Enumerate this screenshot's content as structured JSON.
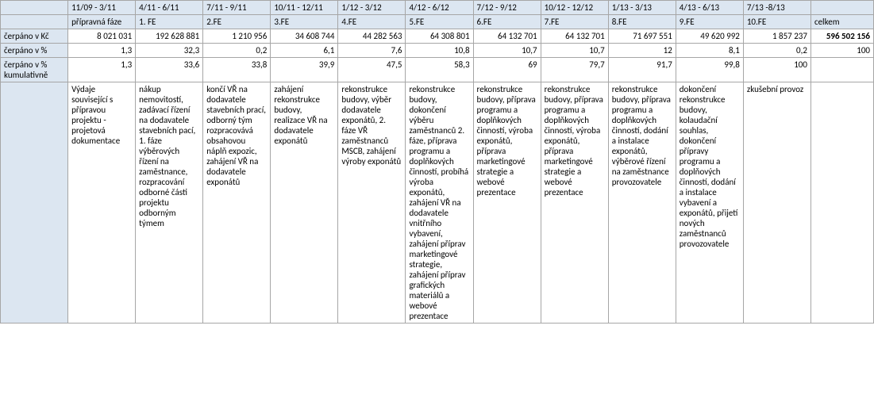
{
  "row_labels": [
    "",
    "",
    "čerpáno v Kč",
    "čerpáno v %",
    "čerpáno v % kumulativně",
    ""
  ],
  "periods": [
    "11/09 - 3/11",
    "4/11 - 6/11",
    "7/11 - 9/11",
    "10/11 - 12/11",
    "1/12 - 3/12",
    "4/12 - 6/12",
    "7/12 - 9/12",
    "10/12 - 12/12",
    "1/13 - 3/13",
    "4/13 - 6/13",
    "7/13 -8/13"
  ],
  "phases": [
    "přípravná fáze",
    "1. FE",
    "2.FE",
    "3.FE",
    "4.FE",
    "5.FE",
    "6.FE",
    "7.FE",
    "8.FE",
    "9.FE",
    "10.FE"
  ],
  "kc": [
    "8 021 031",
    "192 628 881",
    "1 210 956",
    "34 608 744",
    "44 282 563",
    "64 308 801",
    "64 132 701",
    "64 132 701",
    "71 697 551",
    "49 620 992",
    "1 857 237"
  ],
  "pct": [
    "1,3",
    "32,3",
    "0,2",
    "6,1",
    "7,6",
    "10,8",
    "10,7",
    "10,7",
    "12",
    "8,1",
    "0,2"
  ],
  "cum": [
    "1,3",
    "33,6",
    "33,8",
    "39,9",
    "47,5",
    "58,3",
    "69",
    "79,7",
    "91,7",
    "99,8",
    "100"
  ],
  "total_label": "celkem",
  "total_kc": "596 502 156",
  "total_pct": "100",
  "total_cum": "",
  "desc": [
    "Výdaje související s přípravou projektu - projetová dokumentace",
    "nákup nemovitostí, zadávací řízení na dodavatele stavebních pací, 1. fáze výběrových řízení na zaměstnance, rozpracování odborné části projektu odborným týmem",
    "končí VŘ na dodavatele stavebních prací, odborný tým rozpracovává obsahovou náplň expozic, zahájení VŘ na dodavatele exponátů",
    "zahájení rekonstrukce budovy, realizace VŘ na dodavatele exponátů",
    "rekonstrukce budovy, výběr dodavatele exponátů, 2. fáze VŘ zaměstnanců MSCB, zahájení výroby exponátů",
    "rekonstrukce budovy, dokončení výběru zaměstnanců 2. fáze, příprava programu a doplňkových činností, probíhá výroba exponátů, zahájení VŘ na dodavatele vnitřního vybavení, zahájení příprav marketingové strategie, zahájení příprav grafických materiálů a webové prezentace",
    "rekonstrukce budovy, příprava programu a doplňkových činností, výroba exponátů, příprava marketingové strategie a webové prezentace",
    "rekonstrukce budovy, příprava programu a doplňkových činností, výroba exponátů, příprava marketingové strategie a webové prezentace",
    "rekonstrukce budovy, příprava programu a doplňkových činností, dodání a instalace exponátů, výběrové řízení na zaměstnance provozovatele",
    "dokončení rekonstrukce budovy, kolaudační souhlas, dokončení přípravy programu a doplňových činností, dodání a instalace vybavení a exponátů, přijetí nových zaměstnanců provozovatele",
    "zkušební provoz"
  ],
  "chart_data": {
    "type": "table",
    "title": "Čerpání projektu",
    "columns": [
      "11/09 - 3/11",
      "4/11 - 6/11",
      "7/11 - 9/11",
      "10/11 - 12/11",
      "1/12 - 3/12",
      "4/12 - 6/12",
      "7/12 - 9/12",
      "10/12 - 12/12",
      "1/13 - 3/13",
      "4/13 - 6/13",
      "7/13 -8/13",
      "celkem"
    ],
    "series": [
      {
        "name": "čerpáno v Kč",
        "values": [
          8021031,
          192628881,
          1210956,
          34608744,
          44282563,
          64308801,
          64132701,
          64132701,
          71697551,
          49620992,
          1857237,
          596502156
        ]
      },
      {
        "name": "čerpáno v %",
        "values": [
          1.3,
          32.3,
          0.2,
          6.1,
          7.6,
          10.8,
          10.7,
          10.7,
          12,
          8.1,
          0.2,
          100
        ]
      },
      {
        "name": "čerpáno v % kumulativně",
        "values": [
          1.3,
          33.6,
          33.8,
          39.9,
          47.5,
          58.3,
          69,
          79.7,
          91.7,
          99.8,
          100,
          null
        ]
      }
    ]
  }
}
